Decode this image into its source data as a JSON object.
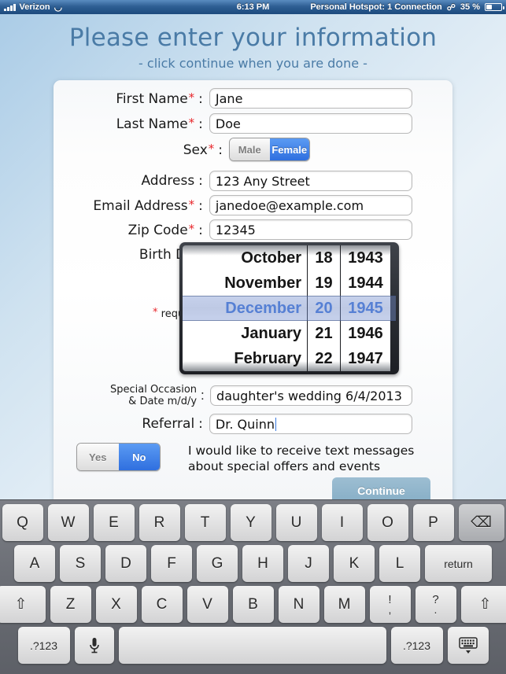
{
  "statusbar": {
    "carrier": "Verizon",
    "time": "6:13 PM",
    "hotspot": "Personal Hotspot: 1 Connection",
    "battery": "35 %"
  },
  "header": {
    "title": "Please enter your information",
    "subtitle": "- click continue when you are done -"
  },
  "form": {
    "first_name": {
      "label": "First Name",
      "required": true,
      "value": "Jane"
    },
    "last_name": {
      "label": "Last Name",
      "required": true,
      "value": "Doe"
    },
    "sex": {
      "label": "Sex",
      "required": true,
      "option_male": "Male",
      "option_female": "Female",
      "selected": "Female"
    },
    "address": {
      "label": "Address",
      "required": false,
      "value": "123 Any Street"
    },
    "email": {
      "label": "Email Address",
      "required": true,
      "value": "janedoe@example.com"
    },
    "zip": {
      "label": "Zip Code",
      "required": true,
      "value": "12345"
    },
    "birth_date": {
      "label": "Birth Date",
      "required": true
    },
    "required_note": "required",
    "special_occasion": {
      "label_line1": "Special Occasion",
      "label_line2": "& Date m/d/y",
      "value": "daughter's wedding 6/4/2013"
    },
    "referral": {
      "label": "Referral",
      "value": "Dr. Quinn"
    },
    "optin": {
      "yes": "Yes",
      "no": "No",
      "selected": "No",
      "text_line1": "I would like to receive text messages",
      "text_line2": "about special offers and events"
    },
    "continue_label": "Continue",
    "colon": ":"
  },
  "date_picker": {
    "months": [
      "October",
      "November",
      "December",
      "January",
      "February"
    ],
    "days": [
      "18",
      "19",
      "20",
      "21",
      "22"
    ],
    "years": [
      "1943",
      "1944",
      "1945",
      "1946",
      "1947"
    ],
    "selected_index": 2,
    "selected_month": "December",
    "selected_day": "20",
    "selected_year": "1945"
  },
  "keyboard": {
    "row1": [
      "Q",
      "W",
      "E",
      "R",
      "T",
      "Y",
      "U",
      "I",
      "O",
      "P"
    ],
    "backspace": "⌫",
    "row2": [
      "A",
      "S",
      "D",
      "F",
      "G",
      "H",
      "J",
      "K",
      "L"
    ],
    "return": "return",
    "row3": [
      "Z",
      "X",
      "C",
      "V",
      "B",
      "N",
      "M"
    ],
    "shift": "⇧",
    "punct1_top": "!",
    "punct1_bottom": ",",
    "punct2_top": "?",
    "punct2_bottom": ".",
    "numeric_left": ".?123",
    "numeric_right": ".?123",
    "mic": "🎤",
    "hide": "⌨",
    "space": ""
  },
  "colors": {
    "accent_blue": "#2f6fdf",
    "title_blue": "#4a7ba6",
    "required_red": "#e8252a",
    "continue_bg": "#8eb4cb"
  }
}
